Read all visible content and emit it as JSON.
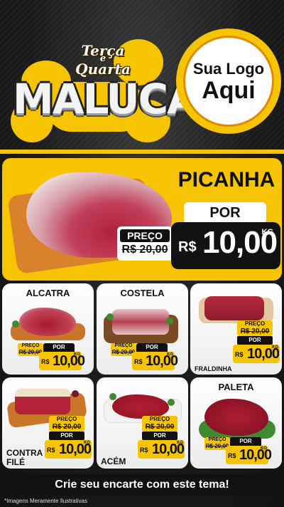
{
  "header": {
    "title_line1": "Terça",
    "title_line2": "e",
    "title_line3": "Quarta",
    "title_main": "MALUCA",
    "logo_line1": "Sua Logo",
    "logo_line2": "Aqui"
  },
  "featured": {
    "name": "PICANHA",
    "por_label": "POR",
    "preco_label": "PREÇO",
    "old_price": "R$ 20,00",
    "currency": "R$",
    "price": "10,00",
    "unit": "KG"
  },
  "products": [
    {
      "name": "ALCATRA",
      "preco_label": "PREÇO",
      "old_price": "R$ 20,00",
      "por_label": "POR",
      "currency": "R$",
      "price": "10,00",
      "unit": "KG"
    },
    {
      "name": "COSTELA",
      "preco_label": "PREÇO",
      "old_price": "R$ 20,00",
      "por_label": "POR",
      "currency": "R$",
      "price": "10,00",
      "unit": "KG"
    },
    {
      "name": "FRALDINHA",
      "preco_label": "PREÇO",
      "old_price": "R$ 20,00",
      "por_label": "POR",
      "currency": "R$",
      "price": "10,00",
      "unit": "KG"
    },
    {
      "name_line1": "CONTRA",
      "name_line2": "FILÉ",
      "preco_label": "PREÇO",
      "old_price": "R$ 20,00",
      "por_label": "POR",
      "currency": "R$",
      "price": "10,00",
      "unit": "KG"
    },
    {
      "name": "ACÉM",
      "preco_label": "PREÇO",
      "old_price": "R$ 20,00",
      "por_label": "POR",
      "currency": "R$",
      "price": "10,00",
      "unit": "KG"
    },
    {
      "name": "PALETA",
      "preco_label": "PREÇO",
      "old_price": "R$ 20,00",
      "por_label": "POR",
      "currency": "R$",
      "price": "10,00",
      "unit": "KG"
    }
  ],
  "footer": {
    "cta": "Crie seu encarte com este tema!",
    "disclaimer": "*Imagens Meramente Ilustrativas"
  },
  "colors": {
    "accent": "#f6c400",
    "dark": "#111111",
    "meat": "#b0203a"
  }
}
